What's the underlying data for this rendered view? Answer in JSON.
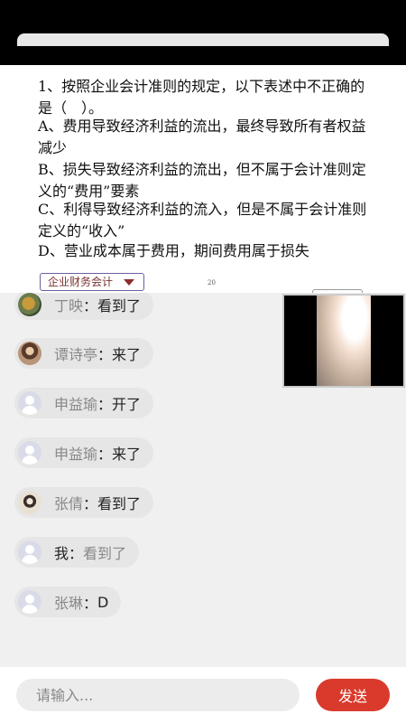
{
  "slide": {
    "question": "1、按照企业会计准则的规定，以下表述中不正确的是（　）。",
    "options": [
      "A、费用导致经济利益的流出，最终导致所有者权益减少",
      "B、损失导致经济利益的流出，但不属于会计准则定义的“费用”要素",
      "C、利得导致经济利益的流入，但是不属于会计准则定义的“收入”",
      "D、营业成本属于费用，期间费用属于损失"
    ],
    "subject_tag": "企业财务会计",
    "page_number": "20"
  },
  "chat": {
    "messages": [
      {
        "name": "丁映",
        "sep": "：",
        "text": "看到了",
        "avatar": "photo-avatar"
      },
      {
        "name": "谭诗亭",
        "sep": "：",
        "text": "来了",
        "avatar": "photo-avatar"
      },
      {
        "name": "申益瑜",
        "sep": "：",
        "text": "开了",
        "avatar": "default-avatar"
      },
      {
        "name": "申益瑜",
        "sep": "：",
        "text": "来了",
        "avatar": "default-avatar"
      },
      {
        "name": "张倩",
        "sep": "：",
        "text": "看到了",
        "avatar": "photo-avatar"
      },
      {
        "name": "我",
        "sep": "：",
        "text": "看到了",
        "avatar": "default-avatar"
      },
      {
        "name": "张琳",
        "sep": "：",
        "text": "D",
        "avatar": "default-avatar"
      }
    ]
  },
  "input": {
    "placeholder": "请输入...",
    "send_label": "发送"
  },
  "colors": {
    "accent": "#d93a2b",
    "bubble": "#e6e6e6",
    "background": "#f0f0f0"
  }
}
